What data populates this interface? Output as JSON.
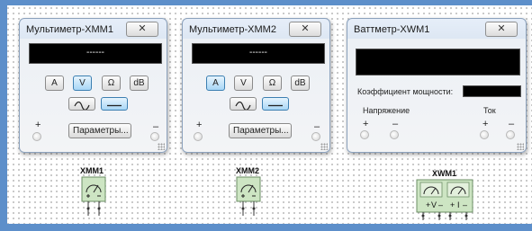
{
  "multimeters": [
    {
      "title": "Мультиметр-XMM1",
      "close": "✕",
      "display": "------",
      "modes": [
        "A",
        "V",
        "Ω",
        "dB"
      ],
      "active_mode": "V",
      "params_label": "Параметры...",
      "plus": "+",
      "minus": "–",
      "component_label": "XMM1"
    },
    {
      "title": "Мультиметр-XMM2",
      "close": "✕",
      "display": "------",
      "modes": [
        "A",
        "V",
        "Ω",
        "dB"
      ],
      "active_mode": "A",
      "params_label": "Параметры...",
      "plus": "+",
      "minus": "–",
      "component_label": "XMM2"
    }
  ],
  "wattmeter": {
    "title": "Ваттметр-XWM1",
    "close": "✕",
    "display": "",
    "power_factor_label": "Коэффициент мощности:",
    "voltage_label": "Напряжение",
    "current_label": "Ток",
    "plus": "+",
    "minus": "–",
    "component_label": "XWM1",
    "symbol_v": "V",
    "symbol_i": "I"
  },
  "colors": {
    "frame": "#5d8fca",
    "active_button": "#a8d6f6",
    "component_fill": "#cde5c3"
  }
}
